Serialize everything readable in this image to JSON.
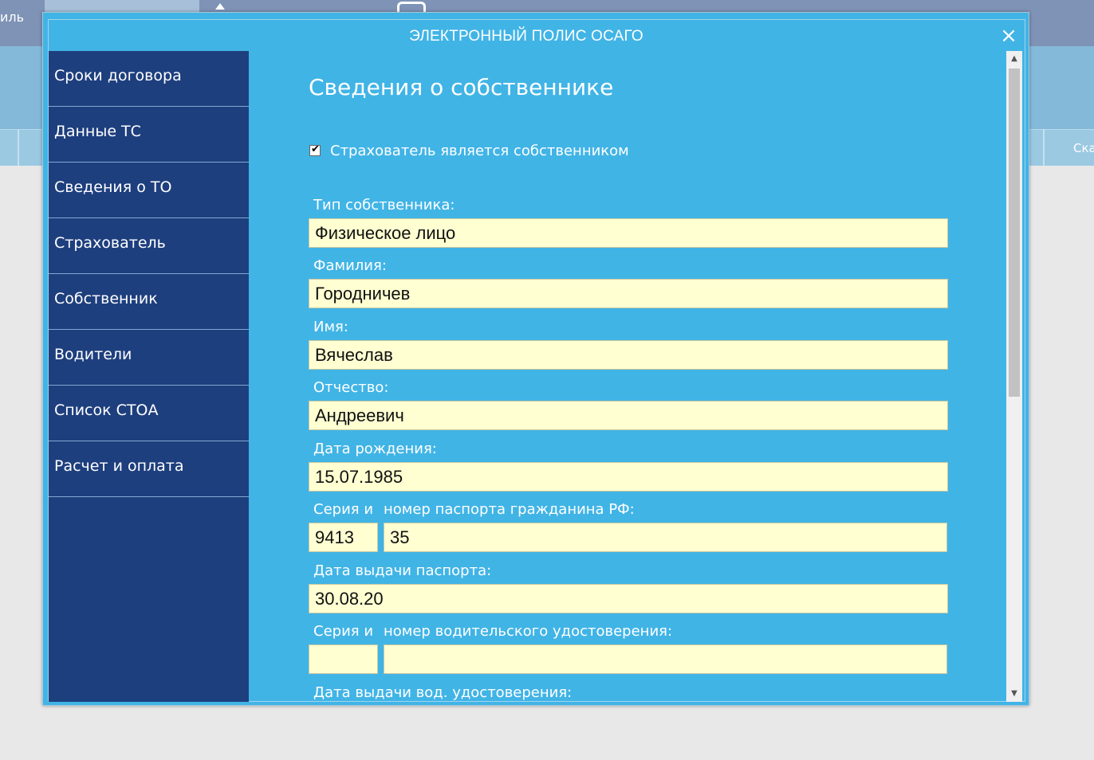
{
  "background": {
    "top_left_text": "иль",
    "right_tab_text": "Ска"
  },
  "modal": {
    "title": "ЭЛЕКТРОННЫЙ ПОЛИС ОСАГО",
    "close_icon": "×"
  },
  "sidebar": {
    "items": [
      {
        "label": "Сроки договора"
      },
      {
        "label": "Данные ТС"
      },
      {
        "label": "Сведения о ТО"
      },
      {
        "label": "Страхователь"
      },
      {
        "label": "Собственник"
      },
      {
        "label": "Водители"
      },
      {
        "label": "Список СТОА"
      },
      {
        "label": "Расчет и оплата"
      }
    ]
  },
  "form": {
    "section_title": "Сведения о собственнике",
    "checkbox_label": "Страхователь является собственником",
    "checkbox_checked": true,
    "owner_type_label": "Тип собственника:",
    "owner_type_value": "Физическое лицо",
    "surname_label": "Фамилия:",
    "surname_value": "Городничев",
    "name_label": "Имя:",
    "name_value": "Вячеслав",
    "patronymic_label": "Отчество:",
    "patronymic_value": "Андреевич",
    "birth_label": "Дата рождения:",
    "birth_value": "15.07.1985",
    "passport_series_label": "Серия и",
    "passport_number_label": "номер паспорта гражданина РФ:",
    "passport_series_value": "9413",
    "passport_number_value": "35",
    "passport_date_label": "Дата выдачи паспорта:",
    "passport_date_value": "30.08.20",
    "license_series_label": "Серия и",
    "license_number_label": "номер водительского удостоверения:",
    "license_series_value": "",
    "license_number_value": "",
    "license_date_label": "Дата выдачи вод. удостоверения:"
  },
  "scrollbar": {
    "up_icon": "▲",
    "down_icon": "▼"
  }
}
